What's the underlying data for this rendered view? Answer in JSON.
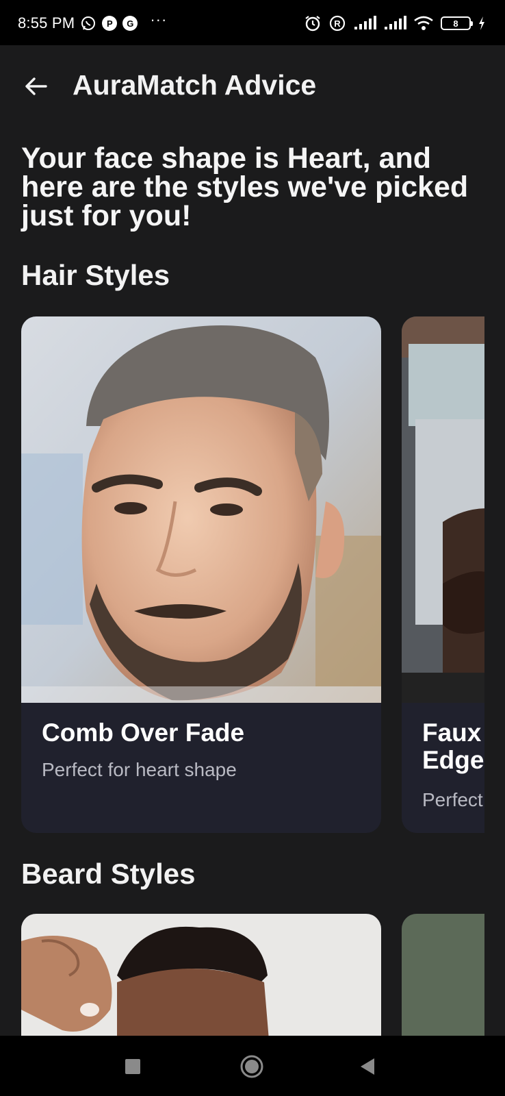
{
  "status_bar": {
    "time": "8:55 PM",
    "left_icons": [
      "whatsapp-icon",
      "app-icon-p",
      "app-icon-g"
    ],
    "overflow": "···",
    "right_icons": [
      "alarm-icon",
      "registered-icon",
      "signal-icon",
      "signal-icon",
      "wifi-icon",
      "battery-icon",
      "charging-icon"
    ],
    "battery_level": "8"
  },
  "app_bar": {
    "back_icon": "arrow-left-icon",
    "title": "AuraMatch Advice"
  },
  "headline": "Your face shape is Heart, and here are the styles we've picked just for you!",
  "hair_section": {
    "title": "Hair Styles",
    "cards": [
      {
        "name": "Comb Over Fade",
        "subtitle": "Perfect for heart shape"
      },
      {
        "name": "Faux Edge",
        "subtitle": "Perfect"
      }
    ]
  },
  "beard_section": {
    "title": "Beard Styles"
  },
  "nav_bar": {
    "icons": [
      "recents-square-icon",
      "home-circle-icon",
      "back-triangle-icon"
    ]
  },
  "colors": {
    "background": "#1b1b1c",
    "card_background": "#20212d",
    "text_primary": "#f2f2f2",
    "text_secondary": "#b9bac3"
  }
}
